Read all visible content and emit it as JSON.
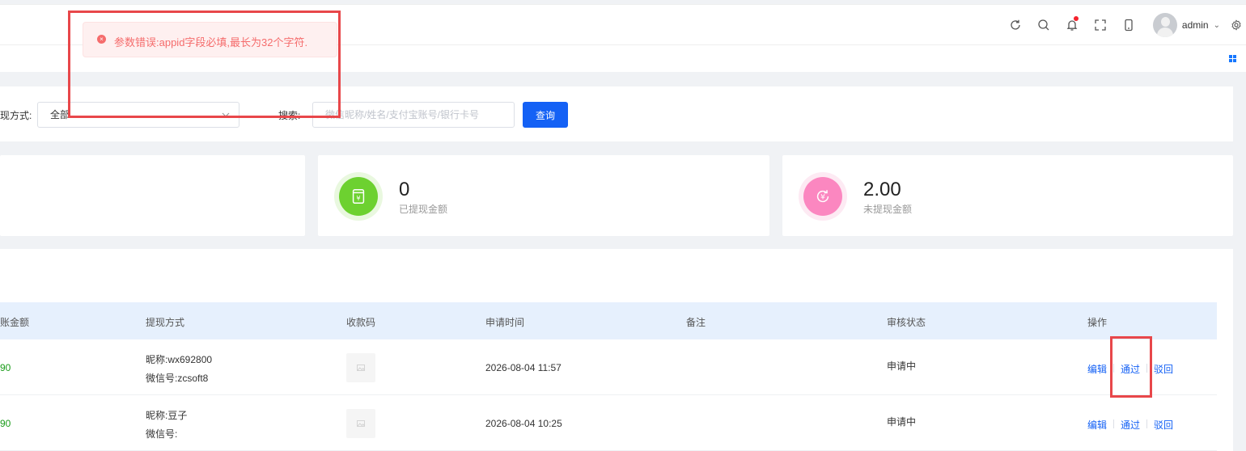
{
  "header": {
    "username": "admin",
    "icons": [
      "refresh-icon",
      "search-icon",
      "bell-icon",
      "fullscreen-icon",
      "mobile-icon",
      "gear-icon"
    ]
  },
  "toast": {
    "message": "参数错误:appid字段必填,最长为32个字符."
  },
  "filters": {
    "method_label": "现方式:",
    "method_value": "全部",
    "search_label": "搜索:",
    "search_placeholder": "微信昵称/姓名/支付宝账号/银行卡号",
    "query_button": "查询"
  },
  "stats": [
    {
      "value": "0",
      "label": "已提现金额",
      "color": "#6dd130",
      "ring": "#e9f8df",
      "icon": "receipt-icon"
    },
    {
      "value": "2.00",
      "label": "未提现金额",
      "color": "#fb87c0",
      "ring": "#fdeaf3",
      "icon": "yuan-cycle-icon"
    }
  ],
  "table": {
    "columns": [
      "账金额",
      "提现方式",
      "收款码",
      "申请时间",
      "备注",
      "审核状态",
      "操作"
    ],
    "rows": [
      {
        "amount": "90",
        "nickname": "昵称:wx692800",
        "wechat": "微信号:zcsoft8",
        "time": "2026-08-04 11:57",
        "remark": "",
        "status": "申请中"
      },
      {
        "amount": "90",
        "nickname": "昵称:豆子",
        "wechat": "微信号:",
        "time": "2026-08-04 10:25",
        "remark": "",
        "status": "申请中"
      }
    ],
    "actions": {
      "edit": "编辑",
      "approve": "通过",
      "reject": "驳回"
    }
  }
}
